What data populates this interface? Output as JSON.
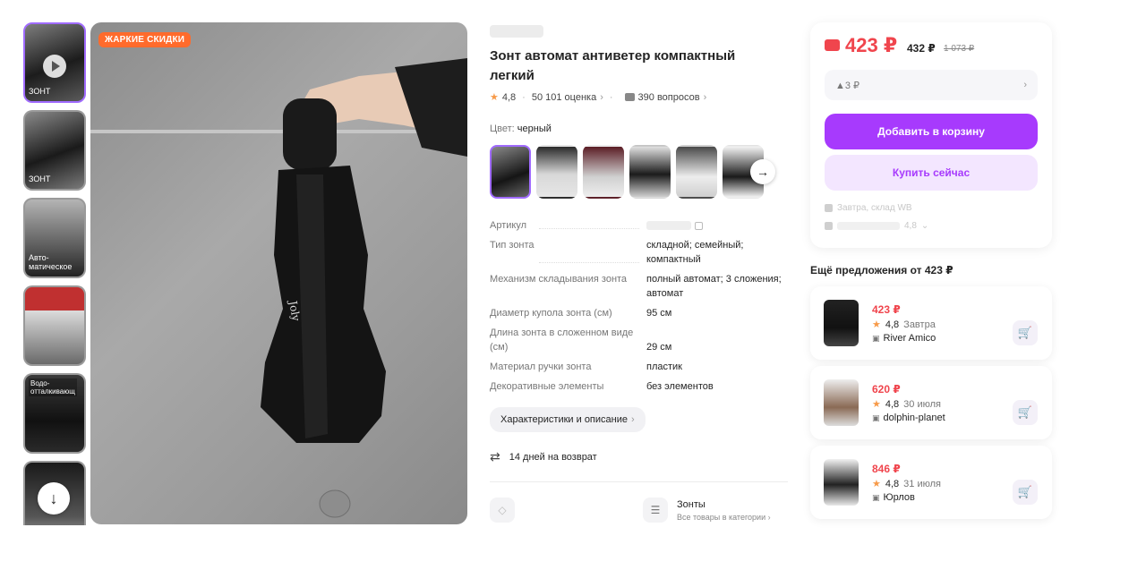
{
  "gallery": {
    "thumbs": [
      {
        "label": "ЗОНТ",
        "has_video": true
      },
      {
        "label": "ЗОНТ",
        "has_video": false
      },
      {
        "label": "Авто-\nматическое",
        "has_video": false
      },
      {
        "label": "",
        "has_video": false
      },
      {
        "label": "Водо-\nотталкивающ",
        "has_video": false
      },
      {
        "label": "",
        "has_video": false
      }
    ],
    "scroll_down_icon": "arrow-down-icon",
    "hot_badge": "ЖАРКИЕ СКИДКИ"
  },
  "product": {
    "title": "Зонт автомат антиветер компактный легкий",
    "rating": "4,8",
    "reviews": "50 101 оценка",
    "questions": "390 вопросов",
    "color_label": "Цвет:",
    "color_value": "черный",
    "specs": [
      {
        "key": "Артикул",
        "value": ""
      },
      {
        "key": "Тип зонта",
        "value": "складной; семейный; компактный"
      },
      {
        "key": "Механизм складывания зонта",
        "value": "полный автомат; 3 сложения; автомат"
      },
      {
        "key": "Диаметр купола зонта (см)",
        "value": "95 см"
      },
      {
        "key": "Длина зонта в сложенном виде (см)",
        "value": "29 см"
      },
      {
        "key": "Материал ручки зонта",
        "value": "пластик"
      },
      {
        "key": "Декоративные элементы",
        "value": "без элементов"
      }
    ],
    "characteristics_button": "Характеристики и описание",
    "return_text": "14 дней на возврат",
    "category_title": "Зонты",
    "category_sub": "Все товары в категории"
  },
  "price_card": {
    "price": "423 ₽",
    "price_alt": "432 ₽",
    "price_old": "1 073 ₽",
    "delta": "▲3 ₽",
    "add_to_cart": "Добавить в корзину",
    "buy_now": "Купить сейчас",
    "delivery": "Завтра, склад WB",
    "seller_rating": "4,8"
  },
  "more_offers": {
    "title": "Ещё предложения от 423 ₽",
    "items": [
      {
        "price": "423 ₽",
        "rating": "4,8",
        "date": "Завтра",
        "seller": "River Amico"
      },
      {
        "price": "620 ₽",
        "rating": "4,8",
        "date": "30 июля",
        "seller": "dolphin-planet"
      },
      {
        "price": "846 ₽",
        "rating": "4,8",
        "date": "31 июля",
        "seller": "Юрлов"
      }
    ]
  },
  "colors": {
    "accent": "#a73afd",
    "price": "#f0454d",
    "badge": "#ff6b2c",
    "star": "#f79a49"
  }
}
